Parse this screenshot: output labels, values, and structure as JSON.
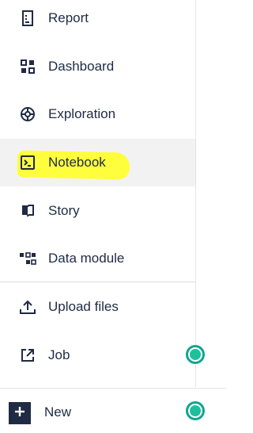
{
  "menu": {
    "items": [
      {
        "label": "Report",
        "icon": "report-icon"
      },
      {
        "label": "Dashboard",
        "icon": "dashboard-icon"
      },
      {
        "label": "Exploration",
        "icon": "exploration-icon"
      },
      {
        "label": "Notebook",
        "icon": "notebook-icon"
      },
      {
        "label": "Story",
        "icon": "story-icon"
      },
      {
        "label": "Data module",
        "icon": "data-module-icon"
      },
      {
        "label": "Upload files",
        "icon": "upload-icon"
      },
      {
        "label": "Job",
        "icon": "job-icon"
      }
    ],
    "active_item": "Notebook"
  },
  "bottom": {
    "new_label": "New",
    "new_icon": "plus-icon"
  },
  "colors": {
    "text": "#1f2a44",
    "highlight": "#ffff2e",
    "status": "#1fbf9c",
    "active_background": "#f2f2f2"
  }
}
